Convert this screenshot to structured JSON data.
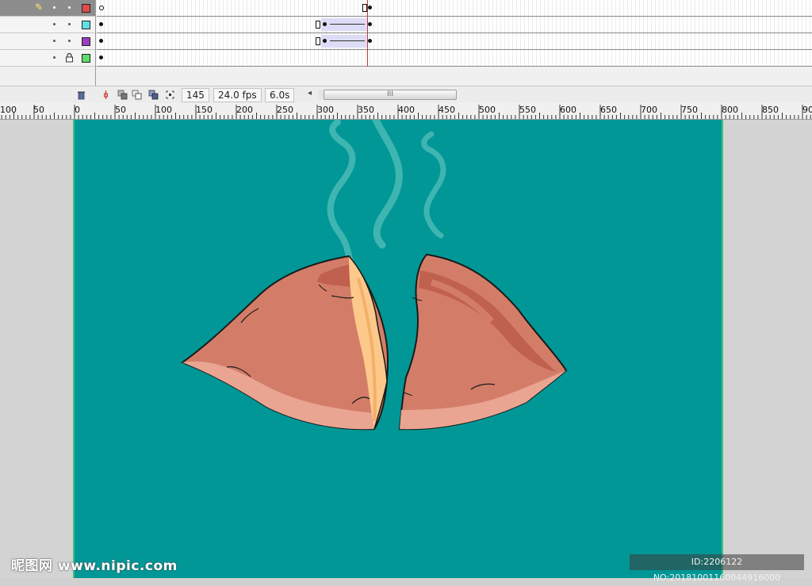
{
  "timeline": {
    "layers": [
      {
        "name": "",
        "color": "#e04a4a",
        "selected": true,
        "locked": false
      },
      {
        "name": "",
        "color": "#5fe0e8",
        "selected": false,
        "locked": false
      },
      {
        "name": "",
        "color": "#9a3fbf",
        "selected": false,
        "locked": false
      },
      {
        "name": "",
        "color": "#5fdc6a",
        "selected": false,
        "locked": true
      }
    ],
    "current_frame": "145",
    "frame_rate": "24.0 fps",
    "elapsed_time": "6.0s",
    "scroll_grip": "III"
  },
  "ruler": {
    "labels": [
      "100",
      "50",
      "0",
      "50",
      "100",
      "150",
      "200",
      "250",
      "300",
      "350",
      "400",
      "450",
      "500",
      "550",
      "600",
      "650",
      "700",
      "750",
      "800",
      "850",
      "90"
    ]
  },
  "stage": {
    "background": "#009796",
    "subject": "sweet-potato",
    "flesh_color": "#f7c78a",
    "skin_color": "#d37d68",
    "steam_color": "#4fbdb8"
  },
  "watermark": {
    "site_name": "昵图网",
    "site_url": "www.nipic.com",
    "id_text": "ID:2206122 NO:20181001160044916000"
  }
}
